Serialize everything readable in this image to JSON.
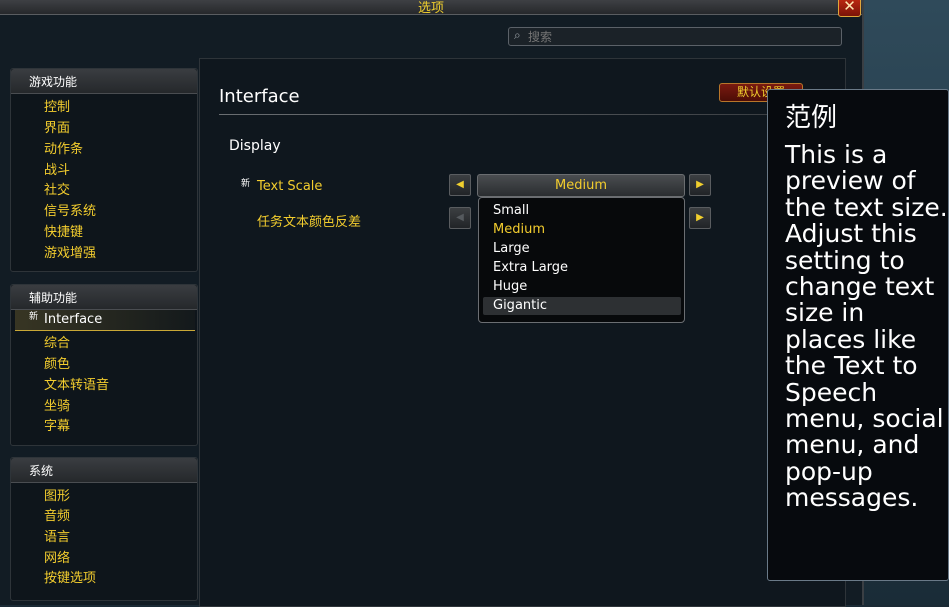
{
  "window": {
    "title": "选项",
    "close_glyph": "✕"
  },
  "search": {
    "placeholder": "搜索",
    "icon": "search-icon"
  },
  "sidebar": {
    "categories": [
      {
        "title": "游戏功能",
        "items": [
          "控制",
          "界面",
          "动作条",
          "战斗",
          "社交",
          "信号系统",
          "快捷键",
          "游戏增强"
        ]
      },
      {
        "title": "辅助功能",
        "items": [
          "Interface",
          "综合",
          "颜色",
          "文本转语音",
          "坐骑",
          "字幕"
        ],
        "selected": "Interface",
        "new_tag": "新"
      },
      {
        "title": "系统",
        "items": [
          "图形",
          "音频",
          "语言",
          "网络",
          "按键选项"
        ]
      }
    ]
  },
  "content": {
    "section_title": "Interface",
    "default_button": "默认设置",
    "group_title": "Display",
    "settings": [
      {
        "label": "Text Scale",
        "value": "Medium",
        "new_tag": "新"
      },
      {
        "label": "任务文本颜色反差"
      }
    ],
    "dropdown": {
      "options": [
        "Small",
        "Medium",
        "Large",
        "Extra Large",
        "Huge",
        "Gigantic"
      ],
      "selected": "Medium",
      "hovered": "Gigantic"
    }
  },
  "tooltip": {
    "title": "范例",
    "body": "This is a preview of the text size. Adjust this setting to change text size in places like the Text to Speech menu, social menu, and pop-up messages."
  },
  "colors": {
    "accent": "#f3cd2e",
    "panel": "#0f171e",
    "button_red": "#7a1a10"
  }
}
